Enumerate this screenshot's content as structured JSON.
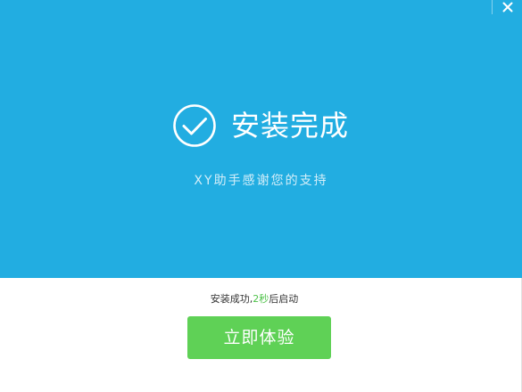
{
  "window": {
    "close_icon": "close-icon"
  },
  "hero": {
    "check_icon": "check-circle-icon",
    "title": "安装完成",
    "subtitle": "XY助手感谢您的支持"
  },
  "status": {
    "prefix": "安装成功,",
    "countdown": "2秒",
    "suffix": "后启动"
  },
  "actions": {
    "start_label": "立即体验"
  },
  "colors": {
    "hero_background": "#22ade1",
    "button_green": "#5fd156",
    "countdown_green": "#4fc24a"
  }
}
